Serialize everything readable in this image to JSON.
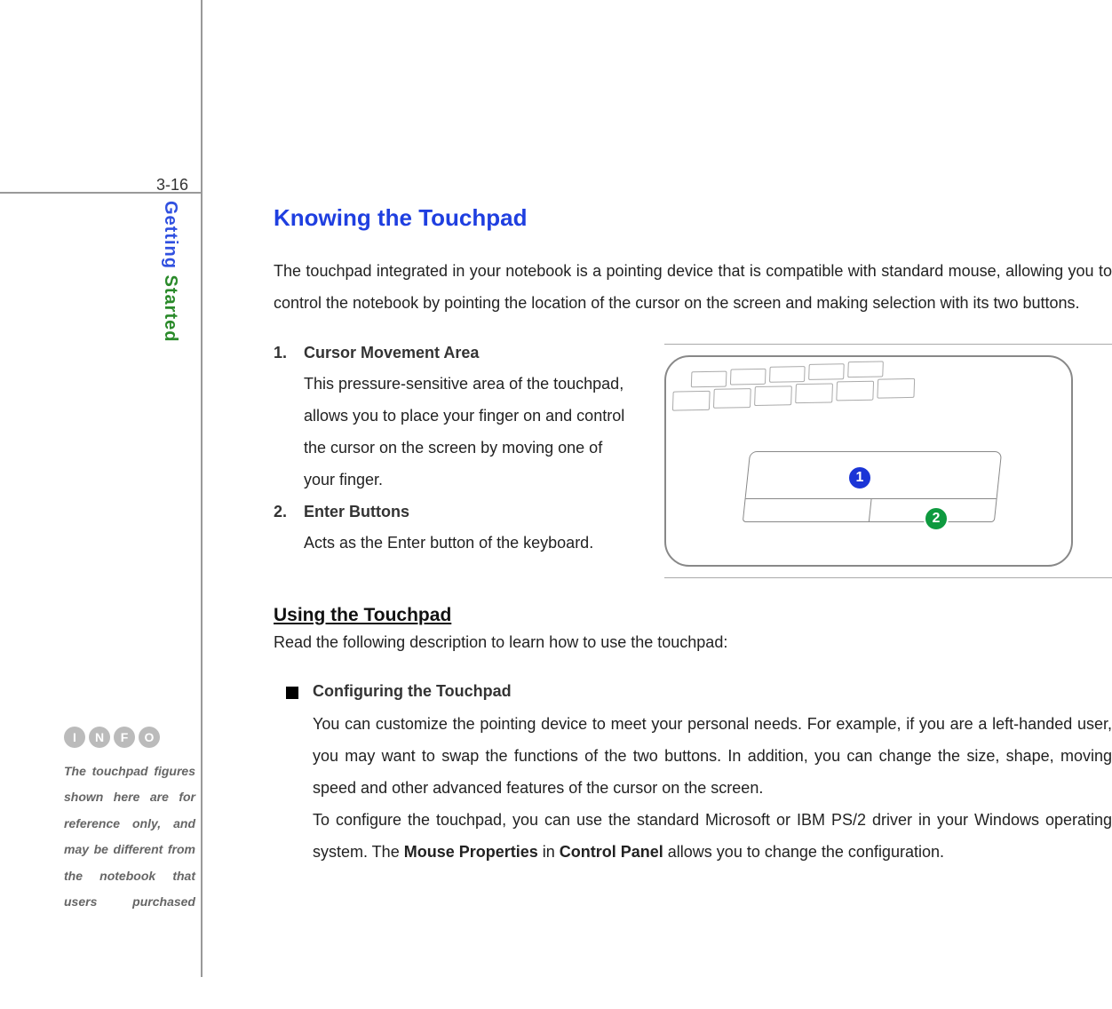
{
  "page_number": "3-16",
  "sidebar": {
    "section_label_part1": "Getting",
    "section_label_part2": " Started",
    "info_letters": [
      "I",
      "N",
      "F",
      "O"
    ],
    "info_note": "The touchpad figures shown here are for reference only, and may be different from the notebook that users purchased"
  },
  "main": {
    "title": "Knowing the Touchpad",
    "intro": "The touchpad integrated in your notebook is a pointing device that is compatible with standard mouse, allowing you to control the notebook by pointing the location of the cursor on the screen and making selection with its two buttons.",
    "list": [
      {
        "num": "1.",
        "title": "Cursor Movement Area",
        "desc": "This pressure-sensitive area of the touchpad, allows you to place your finger on and control the cursor on the screen by moving one of your finger."
      },
      {
        "num": "2.",
        "title": "Enter Buttons",
        "desc": "Acts as the Enter button of the keyboard."
      }
    ],
    "callouts": [
      "1",
      "2"
    ],
    "subheading": "Using the Touchpad",
    "sub_intro": "Read the following description to learn how to use the touchpad:",
    "bullet": {
      "title": "Configuring the Touchpad",
      "body_1": "You can customize the pointing device to meet your personal needs.   For example, if you are a left-handed user, you may want to swap the functions of the two buttons.   In addition, you can change the size, shape, moving speed and other advanced features of the cursor on the screen.",
      "body_2a": "To configure the touchpad, you can use the standard Microsoft or IBM PS/2 driver in your Windows operating system.   The ",
      "body_2_bold1": "Mouse Properties",
      "body_2b": " in ",
      "body_2_bold2": "Control Panel",
      "body_2c": " allows you to change the configuration."
    }
  }
}
